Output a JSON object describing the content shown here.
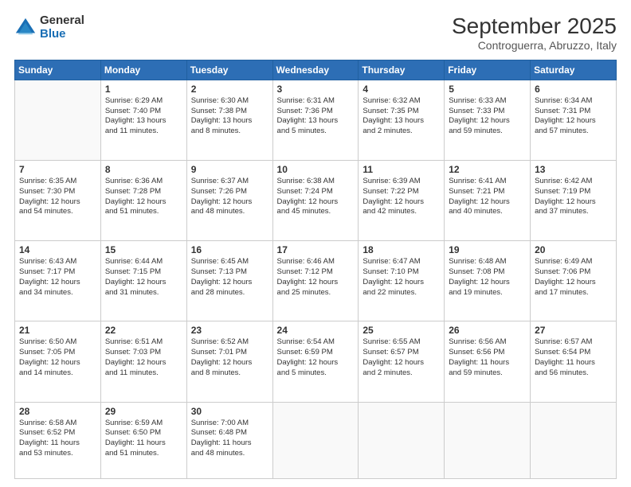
{
  "logo": {
    "general": "General",
    "blue": "Blue"
  },
  "title": "September 2025",
  "subtitle": "Controguerra, Abruzzo, Italy",
  "days_header": [
    "Sunday",
    "Monday",
    "Tuesday",
    "Wednesday",
    "Thursday",
    "Friday",
    "Saturday"
  ],
  "weeks": [
    [
      {
        "num": "",
        "info": ""
      },
      {
        "num": "1",
        "info": "Sunrise: 6:29 AM\nSunset: 7:40 PM\nDaylight: 13 hours\nand 11 minutes."
      },
      {
        "num": "2",
        "info": "Sunrise: 6:30 AM\nSunset: 7:38 PM\nDaylight: 13 hours\nand 8 minutes."
      },
      {
        "num": "3",
        "info": "Sunrise: 6:31 AM\nSunset: 7:36 PM\nDaylight: 13 hours\nand 5 minutes."
      },
      {
        "num": "4",
        "info": "Sunrise: 6:32 AM\nSunset: 7:35 PM\nDaylight: 13 hours\nand 2 minutes."
      },
      {
        "num": "5",
        "info": "Sunrise: 6:33 AM\nSunset: 7:33 PM\nDaylight: 12 hours\nand 59 minutes."
      },
      {
        "num": "6",
        "info": "Sunrise: 6:34 AM\nSunset: 7:31 PM\nDaylight: 12 hours\nand 57 minutes."
      }
    ],
    [
      {
        "num": "7",
        "info": "Sunrise: 6:35 AM\nSunset: 7:30 PM\nDaylight: 12 hours\nand 54 minutes."
      },
      {
        "num": "8",
        "info": "Sunrise: 6:36 AM\nSunset: 7:28 PM\nDaylight: 12 hours\nand 51 minutes."
      },
      {
        "num": "9",
        "info": "Sunrise: 6:37 AM\nSunset: 7:26 PM\nDaylight: 12 hours\nand 48 minutes."
      },
      {
        "num": "10",
        "info": "Sunrise: 6:38 AM\nSunset: 7:24 PM\nDaylight: 12 hours\nand 45 minutes."
      },
      {
        "num": "11",
        "info": "Sunrise: 6:39 AM\nSunset: 7:22 PM\nDaylight: 12 hours\nand 42 minutes."
      },
      {
        "num": "12",
        "info": "Sunrise: 6:41 AM\nSunset: 7:21 PM\nDaylight: 12 hours\nand 40 minutes."
      },
      {
        "num": "13",
        "info": "Sunrise: 6:42 AM\nSunset: 7:19 PM\nDaylight: 12 hours\nand 37 minutes."
      }
    ],
    [
      {
        "num": "14",
        "info": "Sunrise: 6:43 AM\nSunset: 7:17 PM\nDaylight: 12 hours\nand 34 minutes."
      },
      {
        "num": "15",
        "info": "Sunrise: 6:44 AM\nSunset: 7:15 PM\nDaylight: 12 hours\nand 31 minutes."
      },
      {
        "num": "16",
        "info": "Sunrise: 6:45 AM\nSunset: 7:13 PM\nDaylight: 12 hours\nand 28 minutes."
      },
      {
        "num": "17",
        "info": "Sunrise: 6:46 AM\nSunset: 7:12 PM\nDaylight: 12 hours\nand 25 minutes."
      },
      {
        "num": "18",
        "info": "Sunrise: 6:47 AM\nSunset: 7:10 PM\nDaylight: 12 hours\nand 22 minutes."
      },
      {
        "num": "19",
        "info": "Sunrise: 6:48 AM\nSunset: 7:08 PM\nDaylight: 12 hours\nand 19 minutes."
      },
      {
        "num": "20",
        "info": "Sunrise: 6:49 AM\nSunset: 7:06 PM\nDaylight: 12 hours\nand 17 minutes."
      }
    ],
    [
      {
        "num": "21",
        "info": "Sunrise: 6:50 AM\nSunset: 7:05 PM\nDaylight: 12 hours\nand 14 minutes."
      },
      {
        "num": "22",
        "info": "Sunrise: 6:51 AM\nSunset: 7:03 PM\nDaylight: 12 hours\nand 11 minutes."
      },
      {
        "num": "23",
        "info": "Sunrise: 6:52 AM\nSunset: 7:01 PM\nDaylight: 12 hours\nand 8 minutes."
      },
      {
        "num": "24",
        "info": "Sunrise: 6:54 AM\nSunset: 6:59 PM\nDaylight: 12 hours\nand 5 minutes."
      },
      {
        "num": "25",
        "info": "Sunrise: 6:55 AM\nSunset: 6:57 PM\nDaylight: 12 hours\nand 2 minutes."
      },
      {
        "num": "26",
        "info": "Sunrise: 6:56 AM\nSunset: 6:56 PM\nDaylight: 11 hours\nand 59 minutes."
      },
      {
        "num": "27",
        "info": "Sunrise: 6:57 AM\nSunset: 6:54 PM\nDaylight: 11 hours\nand 56 minutes."
      }
    ],
    [
      {
        "num": "28",
        "info": "Sunrise: 6:58 AM\nSunset: 6:52 PM\nDaylight: 11 hours\nand 53 minutes."
      },
      {
        "num": "29",
        "info": "Sunrise: 6:59 AM\nSunset: 6:50 PM\nDaylight: 11 hours\nand 51 minutes."
      },
      {
        "num": "30",
        "info": "Sunrise: 7:00 AM\nSunset: 6:48 PM\nDaylight: 11 hours\nand 48 minutes."
      },
      {
        "num": "",
        "info": ""
      },
      {
        "num": "",
        "info": ""
      },
      {
        "num": "",
        "info": ""
      },
      {
        "num": "",
        "info": ""
      }
    ]
  ]
}
